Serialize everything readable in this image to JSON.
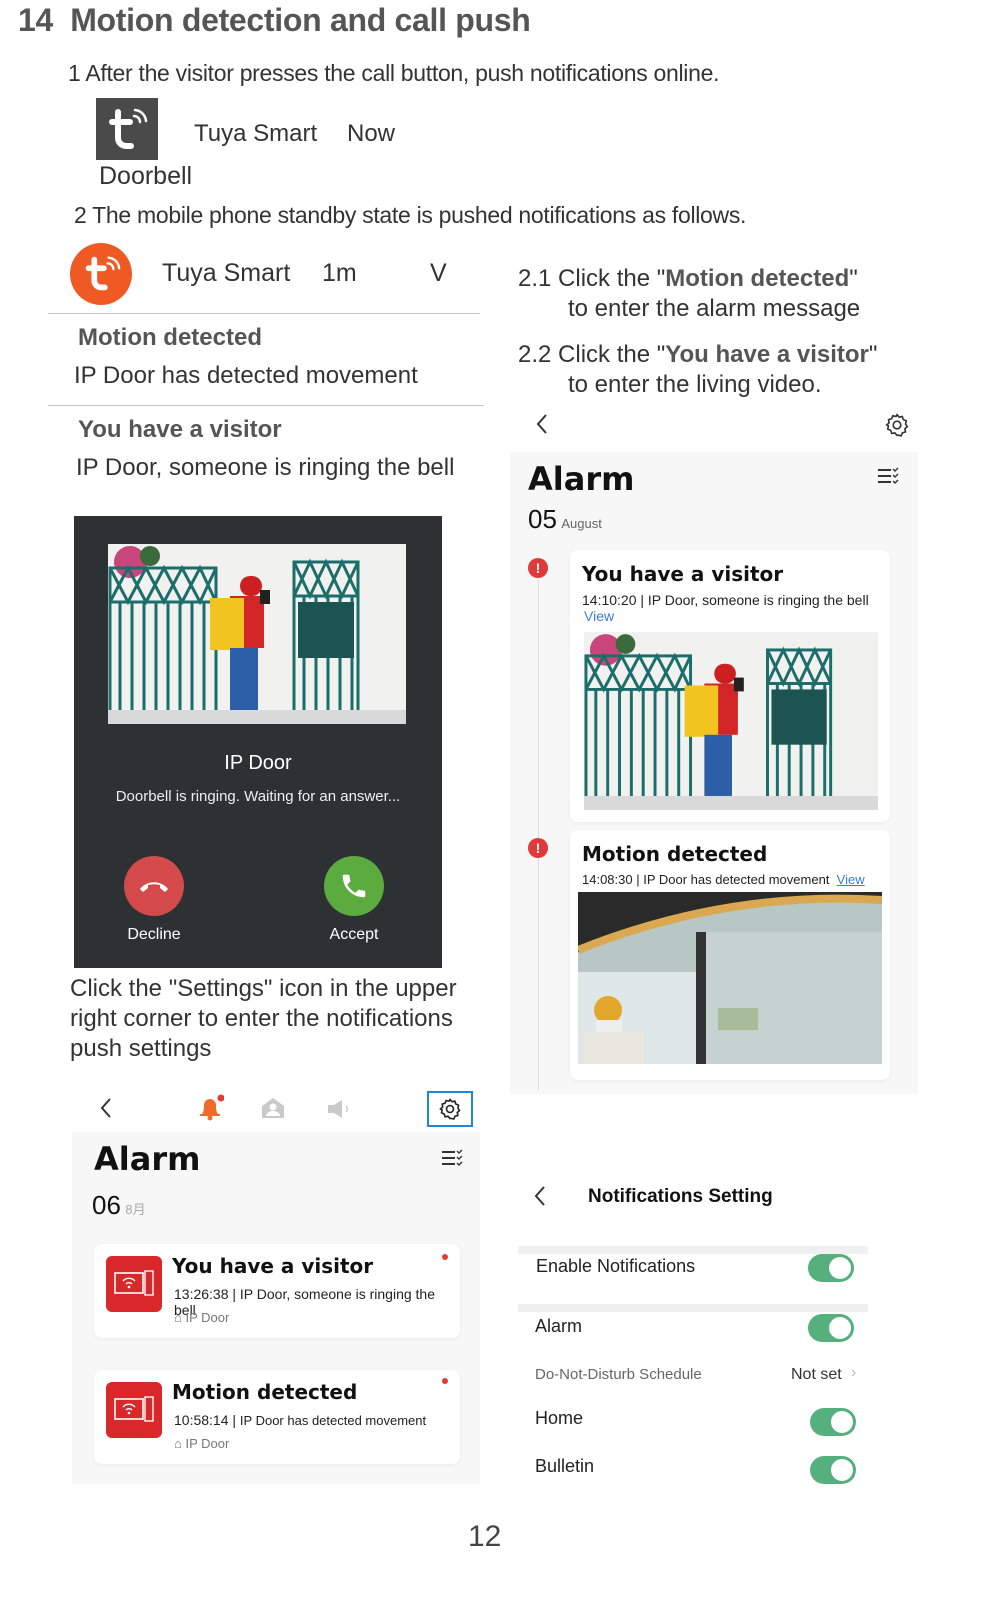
{
  "header": {
    "section_number": "14",
    "title": "Motion detection and call push"
  },
  "step1": {
    "text": "1 After the visitor presses the call button, push notifications online.",
    "notification": {
      "app_name": "Tuya Smart",
      "time": "Now",
      "body": "Doorbell",
      "icon": "tuya-logo-icon"
    }
  },
  "step2": {
    "text": "2  The mobile phone standby state is pushed notifications  as follows.",
    "notification": {
      "app_name": "Tuya Smart",
      "time": "1m",
      "expand": "V",
      "items": [
        {
          "title": "Motion detected",
          "body": "IP Door has detected movement"
        },
        {
          "title": "You have a visitor",
          "body": "IP Door, someone is ringing the bell"
        }
      ]
    }
  },
  "instructions": {
    "s21_prefix": "2.1 Click the \"",
    "s21_bold": "Motion detected",
    "s21_suffix": "\"",
    "s21_line2": "to enter the alarm message",
    "s22_prefix": "2.2 Click the \"",
    "s22_bold": "You have a visitor",
    "s22_suffix": "\"",
    "s22_line2": "to enter the living video.",
    "settings_hint": "Click the \"Settings\" icon in the upper right corner to enter the notifications push settings"
  },
  "call_screen": {
    "device_name": "IP Door",
    "status": "Doorbell is ringing. Waiting for an answer...",
    "decline_label": "Decline",
    "accept_label": "Accept",
    "colors": {
      "decline": "#d44a4a",
      "accept": "#5bab3f",
      "background": "#2e3133"
    }
  },
  "alarm_right": {
    "title": "Alarm",
    "date_day": "05",
    "date_month": "August",
    "events": [
      {
        "title": "You have a visitor",
        "time": "14:10:20",
        "desc": "IP Door, someone is ringing the bell",
        "link": "View"
      },
      {
        "title": "Motion detected",
        "time": "14:08:30",
        "desc": "IP Door has detected movement",
        "link": "View"
      }
    ]
  },
  "alarm_left": {
    "title": "Alarm",
    "date_day": "06",
    "date_month": "8月",
    "events": [
      {
        "title": "You have a visitor",
        "time": "13:26:38",
        "desc": "IP Door, someone is ringing the bell",
        "device": "IP Door"
      },
      {
        "title": "Motion detected",
        "time": "10:58:14",
        "desc": "IP Door has detected movement",
        "device": "IP Door"
      }
    ]
  },
  "notification_settings": {
    "title": "Notifications Setting",
    "rows": [
      {
        "label": "Enable Notifications",
        "on": true
      },
      {
        "label": "Alarm",
        "on": true
      },
      {
        "label": "Do-Not-Disturb Schedule",
        "value": "Not set"
      },
      {
        "label": "Home",
        "on": true
      },
      {
        "label": "Bulletin",
        "on": true
      }
    ],
    "toggle_color": "#55b07e"
  },
  "page_number": "12"
}
